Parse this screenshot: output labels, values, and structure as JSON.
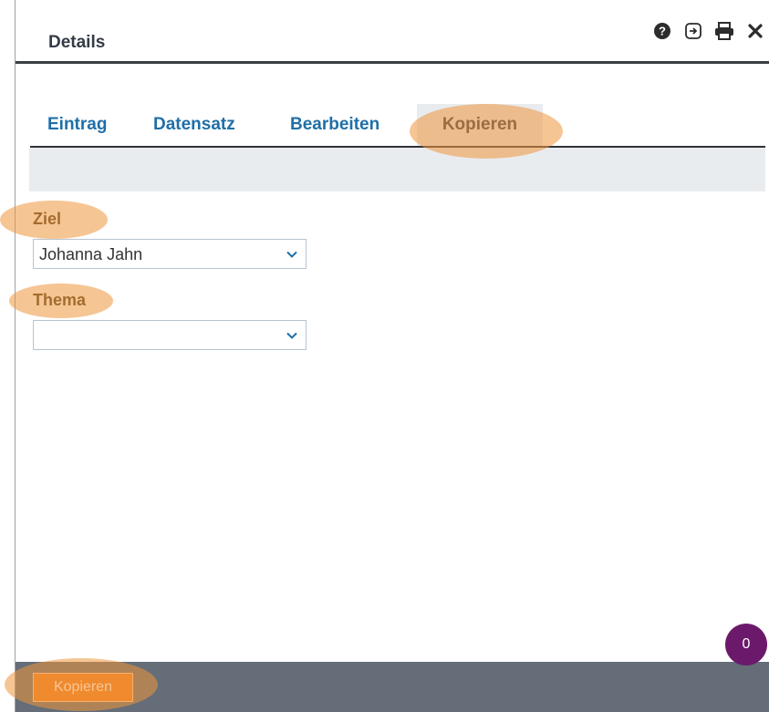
{
  "window": {
    "title": "Details",
    "icons": [
      "help-icon",
      "popout-icon",
      "print-icon",
      "close-icon"
    ]
  },
  "tabs": [
    {
      "label": "Eintrag",
      "active": false
    },
    {
      "label": "Datensatz",
      "active": false
    },
    {
      "label": "Bearbeiten",
      "active": false
    },
    {
      "label": "Kopieren",
      "active": true
    }
  ],
  "form": {
    "ziel": {
      "label": "Ziel",
      "value": "Johanna Jahn"
    },
    "thema": {
      "label": "Thema",
      "value": ""
    }
  },
  "footer": {
    "button_label": "Kopieren"
  },
  "badge": {
    "count": "0"
  },
  "colors": {
    "accent": "#f07d1d",
    "highlight": "#ee963c",
    "tab_link": "#1f6fa8",
    "footer": "#646d78",
    "badge": "#6b1a6b"
  }
}
